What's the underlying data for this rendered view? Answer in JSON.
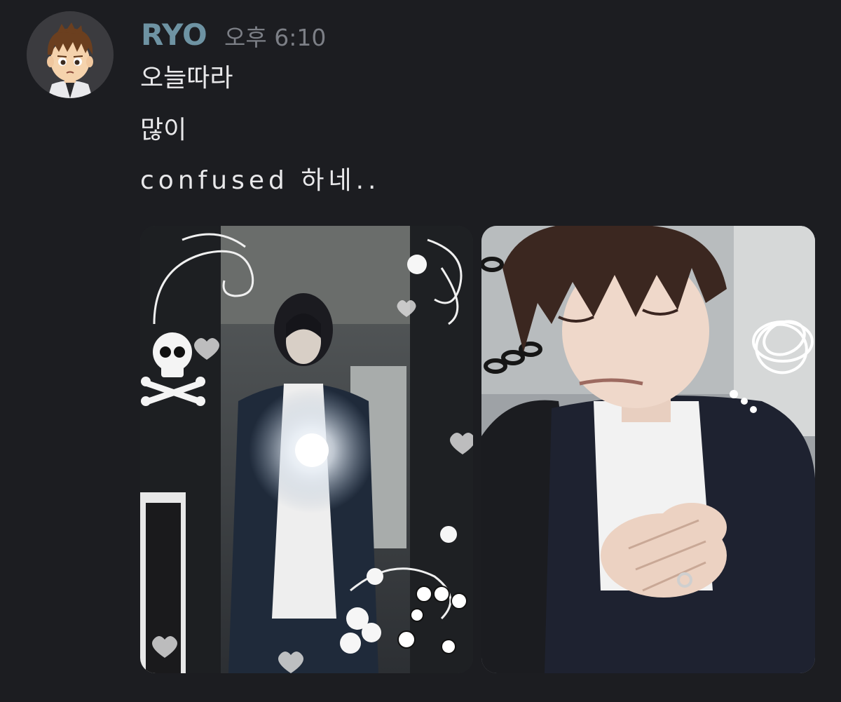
{
  "message": {
    "username": "RYO",
    "timestamp": "오후 6:10",
    "lines": [
      "오늘따라",
      "많이",
      "confused 하네.."
    ]
  },
  "avatar": {
    "icon": "cartoon-boy-avatar-icon"
  },
  "attachments": [
    {
      "kind": "image",
      "icon": "mirror-selfie-photo"
    },
    {
      "kind": "image",
      "icon": "portrait-photo"
    }
  ],
  "colors": {
    "background": "#1c1d21",
    "username": "#6e93a3",
    "timestamp": "#7c7f86",
    "text": "#e8e8ea"
  }
}
